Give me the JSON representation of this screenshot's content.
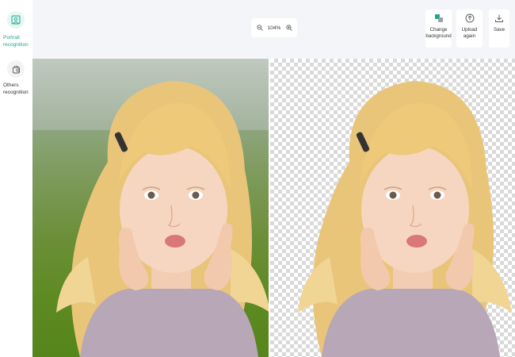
{
  "sidebar": {
    "items": [
      {
        "label": "Portrait recognition",
        "icon": "portrait-icon",
        "active": true
      },
      {
        "label": "Others recognition",
        "icon": "objects-icon",
        "active": false
      }
    ]
  },
  "toolbar": {
    "zoom": {
      "value": "104%",
      "zoom_out_icon": "zoom-out-icon",
      "zoom_in_icon": "zoom-in-icon"
    },
    "change_background": {
      "label": "Change background",
      "icon": "background-icon"
    },
    "upload_again": {
      "label": "Upload again",
      "icon": "upload-icon"
    },
    "save": {
      "label": "Save",
      "icon": "download-icon"
    }
  },
  "canvas": {
    "original_image": "portrait-photo-original",
    "result_image": "portrait-photo-background-removed"
  },
  "colors": {
    "accent": "#1aa88d",
    "topbar_bg": "#f4f5f8",
    "checker": "#d9d9d9"
  }
}
